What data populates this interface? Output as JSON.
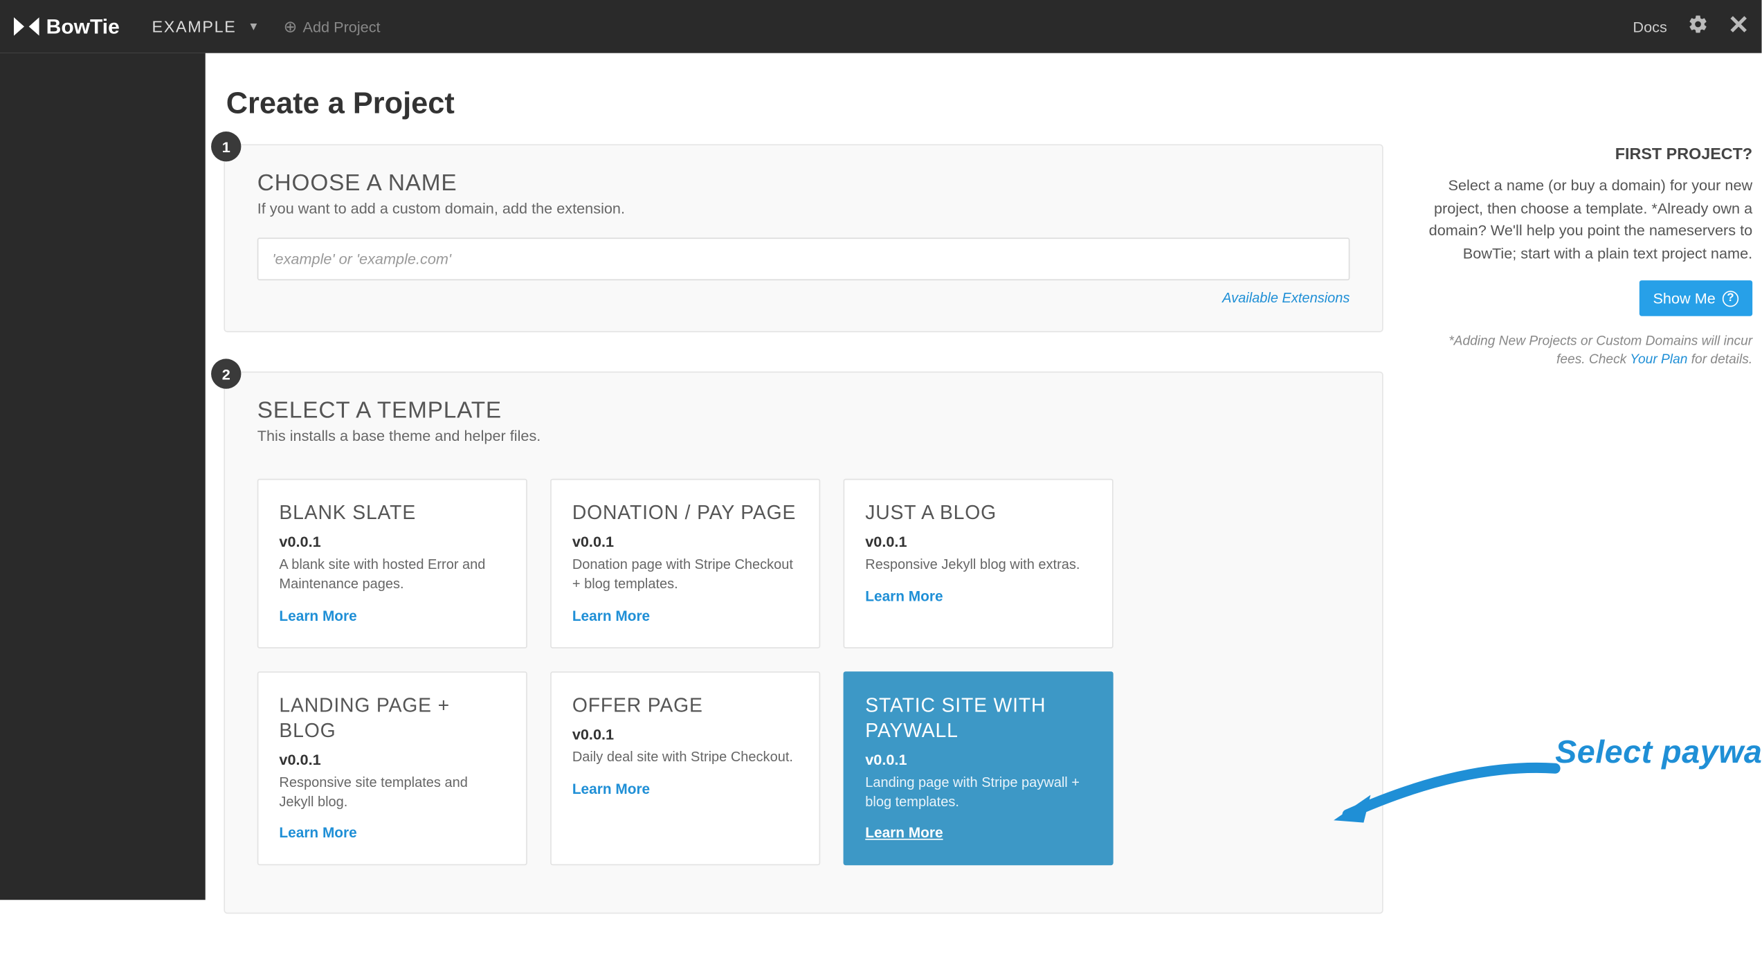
{
  "brand": "BowTie",
  "topbar": {
    "project_label": "EXAMPLE",
    "add_project": "Add Project",
    "docs_label": "Docs"
  },
  "page": {
    "title": "Create a Project"
  },
  "step1": {
    "badge": "1",
    "title": "CHOOSE A NAME",
    "subtitle": "If you want to add a custom domain, add the extension.",
    "placeholder": "'example' or 'example.com'",
    "extensions_link": "Available Extensions"
  },
  "step2": {
    "badge": "2",
    "title": "SELECT A TEMPLATE",
    "subtitle": "This installs a base theme and helper files.",
    "templates": [
      {
        "title": "BLANK SLATE",
        "version": "v0.0.1",
        "desc": "A blank site with hosted Error and Maintenance pages.",
        "learn": "Learn More",
        "selected": false
      },
      {
        "title": "DONATION / PAY PAGE",
        "version": "v0.0.1",
        "desc": "Donation page with Stripe Checkout + blog templates.",
        "learn": "Learn More",
        "selected": false
      },
      {
        "title": "JUST A BLOG",
        "version": "v0.0.1",
        "desc": "Responsive Jekyll blog with extras.",
        "learn": "Learn More",
        "selected": false
      },
      {
        "title": "LANDING PAGE + BLOG",
        "version": "v0.0.1",
        "desc": "Responsive site templates and Jekyll blog.",
        "learn": "Learn More",
        "selected": false
      },
      {
        "title": "OFFER PAGE",
        "version": "v0.0.1",
        "desc": "Daily deal site with Stripe Checkout.",
        "learn": "Learn More",
        "selected": false
      },
      {
        "title": "STATIC SITE WITH PAYWALL",
        "version": "v0.0.1",
        "desc": "Landing page with Stripe paywall + blog templates.",
        "learn": "Learn More",
        "selected": true
      }
    ]
  },
  "help": {
    "title": "FIRST PROJECT?",
    "body": "Select a name (or buy a domain) for your new project, then choose a template. *Already own a domain? We'll help you point the nameservers to BowTie; start with a plain text project name.",
    "show_me": "Show Me",
    "foot_pre": "*Adding New Projects or Custom Domains will incur fees. Check ",
    "foot_link": "Your Plan",
    "foot_post": " for details."
  },
  "annotation": {
    "text": "Select paywall template"
  }
}
